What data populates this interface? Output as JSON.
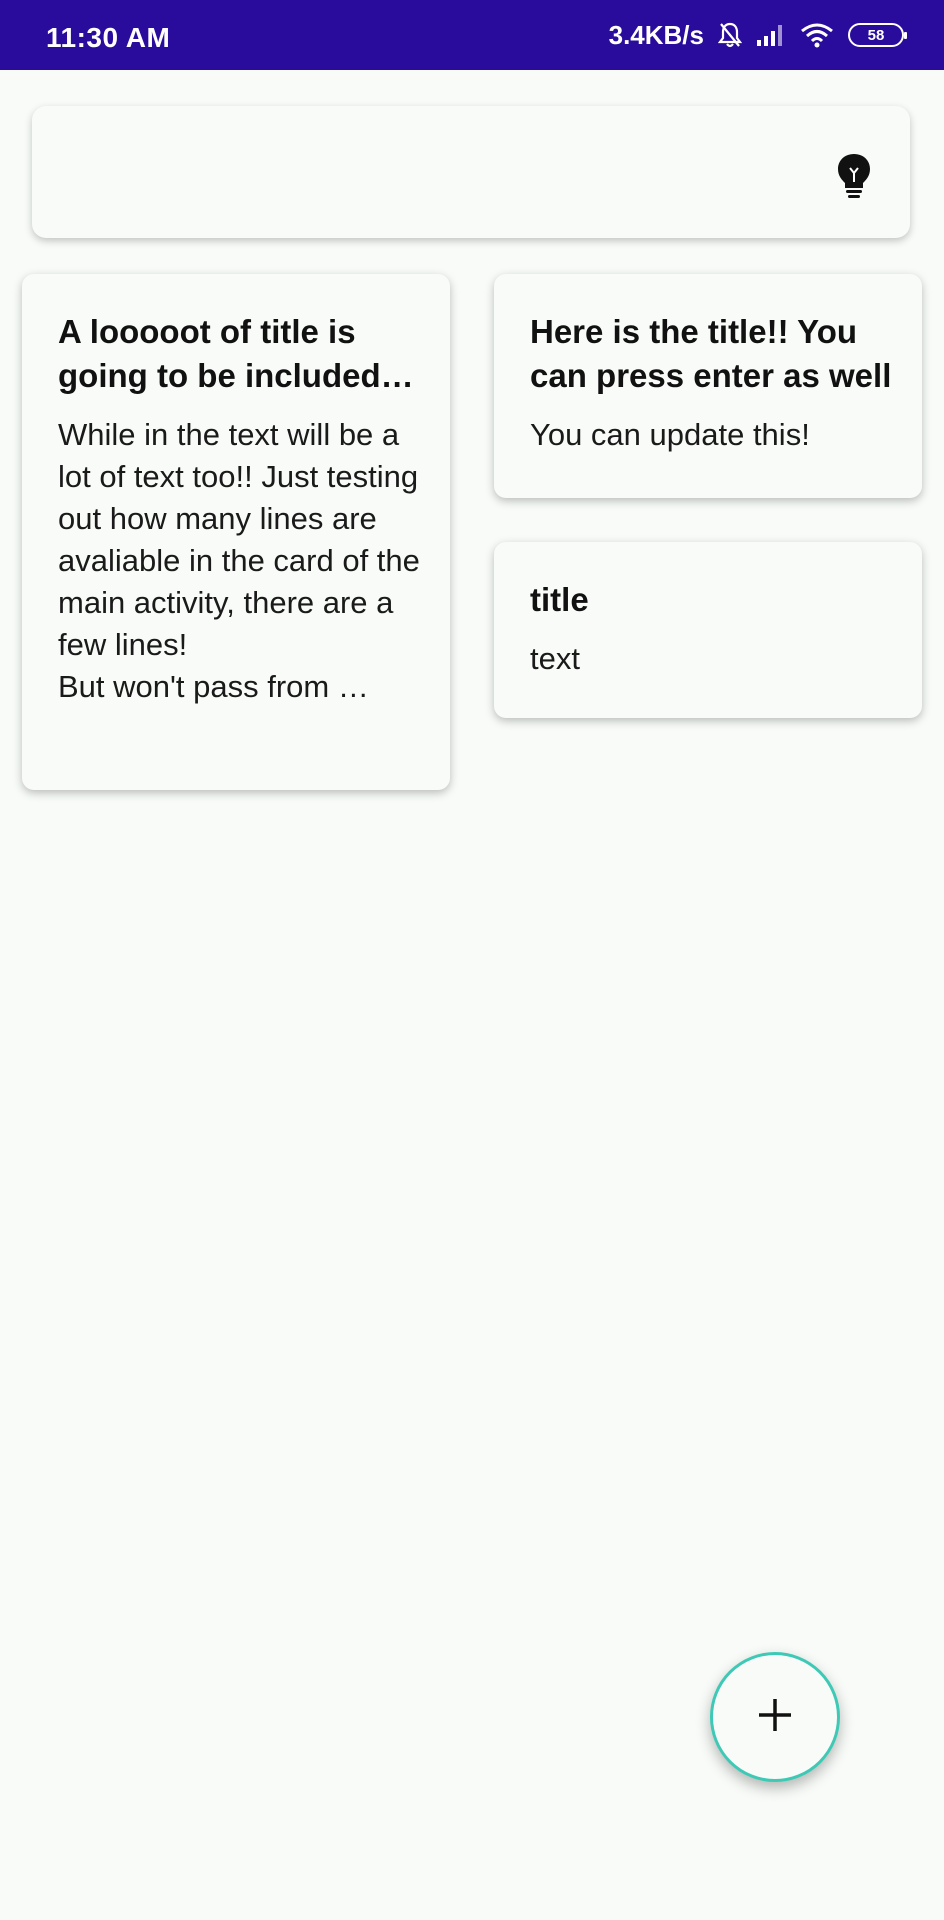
{
  "status_bar": {
    "time": "11:30 AM",
    "speed": "3.4KB/s",
    "battery": "58",
    "icons": [
      "bell-off-icon",
      "signal-icon",
      "wifi-icon",
      "battery-icon"
    ]
  },
  "search_bar": {
    "icon": "lightbulb-icon"
  },
  "notes": [
    {
      "title": "A looooot of title is going to be included in this note",
      "text": "While in the text will be a lot of text too!! Just testing out how many lines are avaliable in the card of the main activity, there are a few lines!\nBut won't pass from …"
    },
    {
      "title": "Here is the title!! You can press enter as well",
      "text": "You can update this!"
    },
    {
      "title": "title",
      "text": "text"
    }
  ],
  "fab": {
    "icon": "plus-icon"
  },
  "colors": {
    "status_bar": "#2A0C9C",
    "background": "#F8FBF8",
    "fab_border": "#3EC9B6"
  }
}
